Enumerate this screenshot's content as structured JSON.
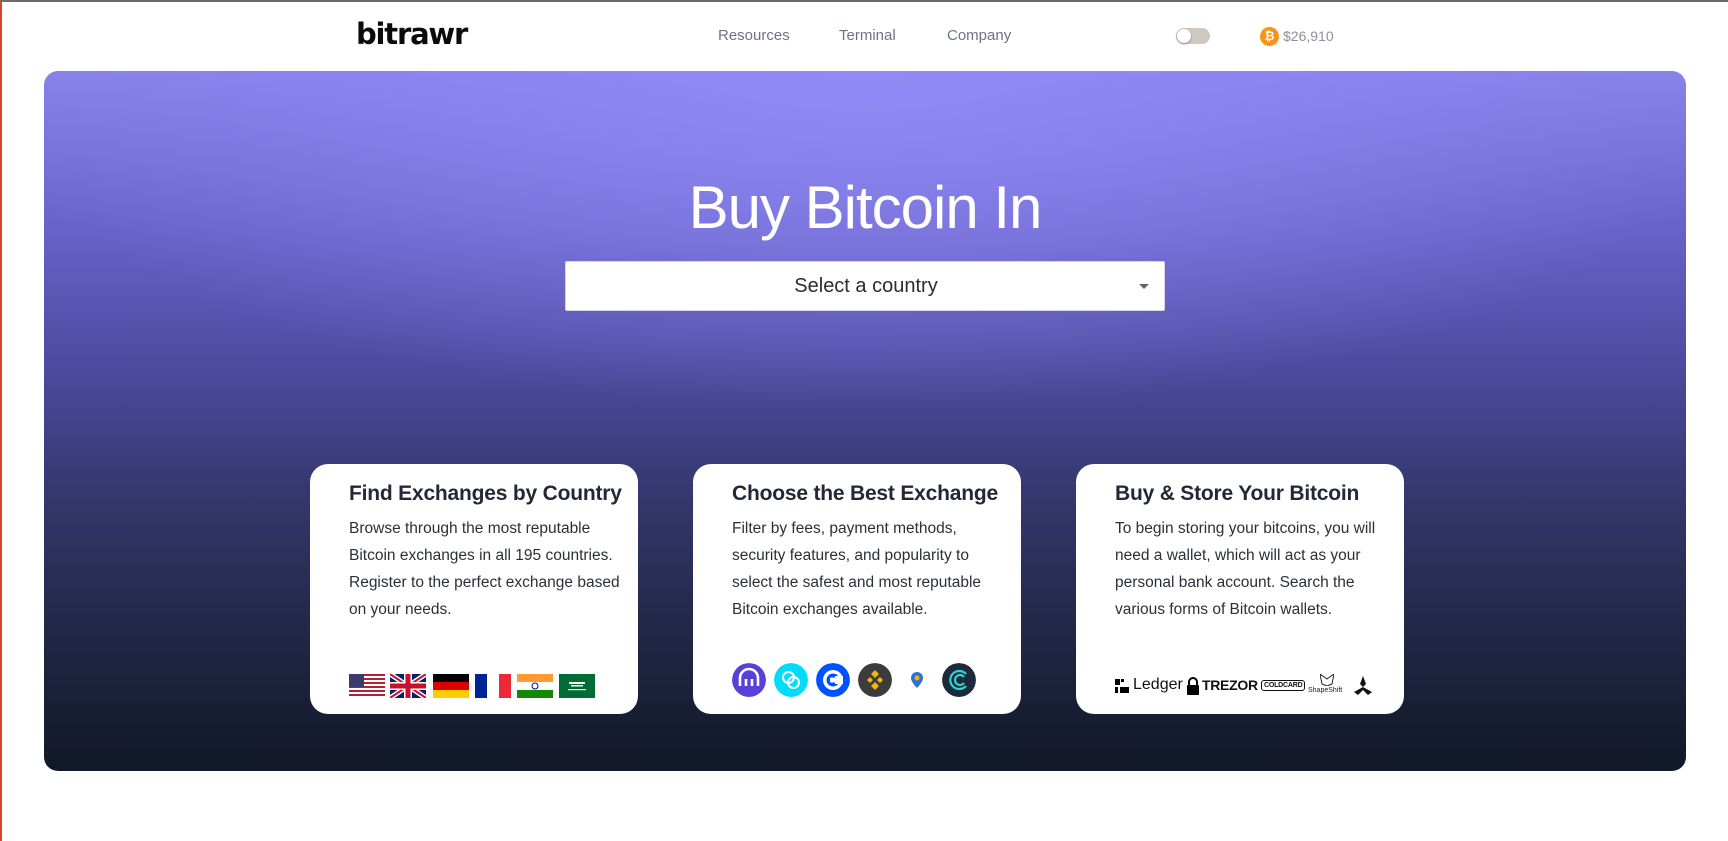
{
  "header": {
    "logo": "bitrawr",
    "nav": [
      {
        "label": "Resources"
      },
      {
        "label": "Terminal"
      },
      {
        "label": "Company"
      }
    ],
    "theme_toggle_state": "off",
    "btc_symbol": "₿",
    "btc_price": "$26,910"
  },
  "hero": {
    "title": "Buy Bitcoin In",
    "country_select": {
      "value": "Select a country"
    }
  },
  "cards": [
    {
      "title": "Find Exchanges by Country",
      "body": "Browse through the most reputable Bitcoin exchanges in all 195 countries. Register to the perfect exchange based on your needs.",
      "flags": [
        "us-flag-icon",
        "uk-flag-icon",
        "germany-flag-icon",
        "france-flag-icon",
        "india-flag-icon",
        "saudi-arabia-flag-icon"
      ]
    },
    {
      "title": "Choose the Best Exchange",
      "body": "Filter by fees, payment methods, security features, and popularity to select the safest and most reputable Bitcoin exchanges available.",
      "exchanges": [
        "kraken-icon",
        "gemini-icon",
        "coinbase-icon",
        "binance-icon",
        "bisq-icon",
        "cex-icon"
      ]
    },
    {
      "title": "Buy & Store Your Bitcoin",
      "body": "To begin storing your bitcoins, you will need a wallet, which will act as your personal bank account. Search the various forms of Bitcoin wallets.",
      "wallets": {
        "ledger": "Ledger",
        "trezor": "TREZOR",
        "coldcard": "COLDCARD",
        "shapeshift": "ShapeShift"
      }
    }
  ],
  "colors": {
    "hero_top": "#8582e9",
    "hero_bottom": "#111827",
    "btc_orange": "#f7931a",
    "nav_text": "#6b7383"
  }
}
